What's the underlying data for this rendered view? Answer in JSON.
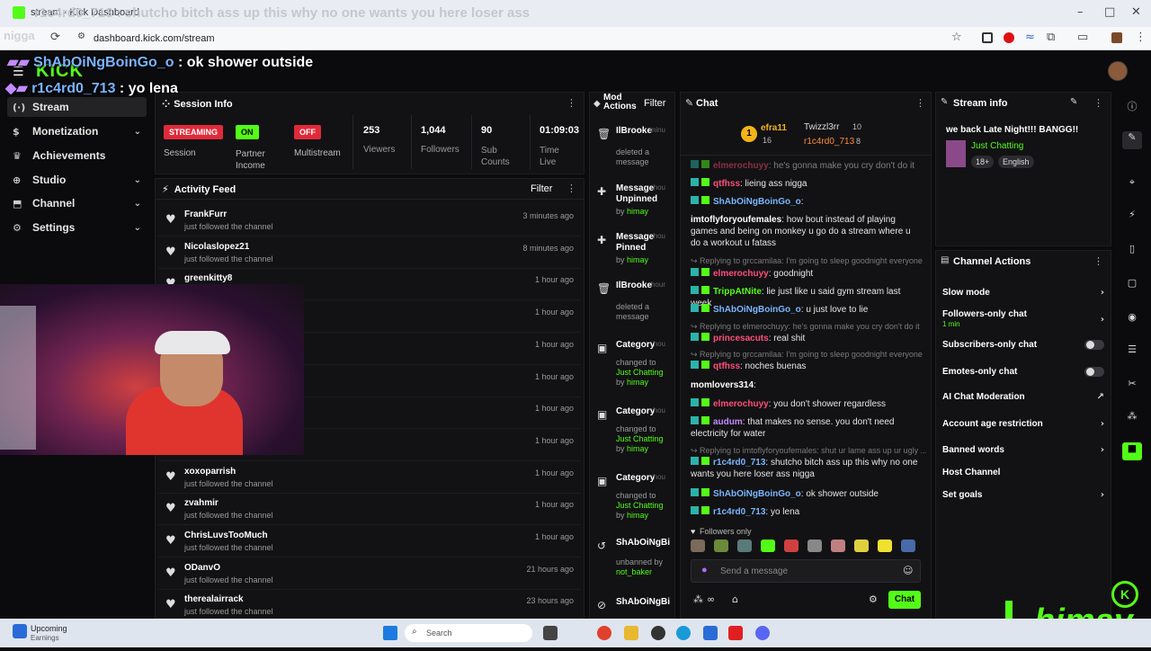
{
  "browser": {
    "tab_title": "stream - Kick Dashboard",
    "url": "dashboard.kick.com/stream",
    "minimize": "–",
    "maximize": "□",
    "close": "✕"
  },
  "overlay": {
    "top_text": "r1c4rd0_713 : shutcho bitch ass up this why no one wants you here loser ass",
    "top_left_fragment": "nigga",
    "line1_user": "ShAbOiNgBoinGo_o",
    "line1_msg": " : ok shower outside",
    "line2_user": "r1c4rd0_713",
    "line2_msg": " : yo lena",
    "brand_logo": "KICK",
    "streamer_logo": "himay"
  },
  "sidebar": {
    "items": [
      {
        "label": "Stream",
        "icon": "broadcast-icon"
      },
      {
        "label": "Monetization",
        "icon": "dollar-icon"
      },
      {
        "label": "Achievements",
        "icon": "trophy-icon"
      },
      {
        "label": "Studio",
        "icon": "studio-icon"
      },
      {
        "label": "Channel",
        "icon": "channel-icon"
      },
      {
        "label": "Settings",
        "icon": "gear-icon"
      }
    ]
  },
  "session": {
    "title": "Session Info",
    "streaming": "STREAMING",
    "streaming_label": "Session",
    "partner": "ON",
    "partner_label1": "Partner",
    "partner_label2": "Income",
    "multistream": "OFF",
    "multistream_label": "Multistream",
    "viewers": "253",
    "viewers_label": "Viewers",
    "followers": "1,044",
    "followers_label": "Followers",
    "subs": "90",
    "subs_label1": "Sub",
    "subs_label2": "Counts",
    "time": "01:09:03",
    "time_label1": "Time",
    "time_label2": "Live"
  },
  "activity": {
    "title": "Activity Feed",
    "filter": "Filter",
    "rows": [
      {
        "name": "FrankFurr",
        "sub": "just followed the channel",
        "time": "3 minutes ago"
      },
      {
        "name": "Nicolaslopez21",
        "sub": "just followed the channel",
        "time": "8 minutes ago"
      },
      {
        "name": "greenkitty8",
        "sub": "",
        "time": "1 hour ago"
      },
      {
        "name": "",
        "sub": "",
        "time": "1 hour ago"
      },
      {
        "name": "",
        "sub": "",
        "time": "1 hour ago"
      },
      {
        "name": "",
        "sub": "",
        "time": "1 hour ago"
      },
      {
        "name": "",
        "sub": "",
        "time": "1 hour ago"
      },
      {
        "name": "",
        "sub": "",
        "time": "1 hour ago"
      },
      {
        "name": "xoxoparrish",
        "sub": "just followed the channel",
        "time": "1 hour ago"
      },
      {
        "name": "zvahmir",
        "sub": "just followed the channel",
        "time": "1 hour ago"
      },
      {
        "name": "ChrisLuvsTooMuch",
        "sub": "just followed the channel",
        "time": "1 hour ago"
      },
      {
        "name": "ODanvO",
        "sub": "just followed the channel",
        "time": "21 hours ago"
      },
      {
        "name": "therealairrack",
        "sub": "just followed the channel",
        "time": "23 hours ago"
      }
    ]
  },
  "mod": {
    "title1": "Mod",
    "title2": "Actions",
    "filter": "Filter",
    "items": [
      {
        "icon": "trash-icon",
        "t": "IlBrooke",
        "d1": "deleted a",
        "d2": "message",
        "d3": "",
        "h": "minu"
      },
      {
        "icon": "pin-icon",
        "t": "Message Unpinned",
        "d1": "by",
        "d2": "himay",
        "d3": "",
        "h": "hou"
      },
      {
        "icon": "pin-icon",
        "t": "Message Pinned",
        "d1": "by",
        "d2": "himay",
        "d3": "",
        "h": "hou"
      },
      {
        "icon": "trash-icon",
        "t": "IlBrooke",
        "d1": "deleted a",
        "d2": "message",
        "d3": "",
        "h": "hour"
      },
      {
        "icon": "category-icon",
        "t": "Category",
        "d1": "changed to",
        "d2": "Just Chatting",
        "d3": "himay",
        "h": "hou"
      },
      {
        "icon": "category-icon",
        "t": "Category",
        "d1": "changed to",
        "d2": "Just Chatting",
        "d3": "himay",
        "h": "hou"
      },
      {
        "icon": "category-icon",
        "t": "Category",
        "d1": "changed to",
        "d2": "Just Chatting",
        "d3": "himay",
        "h": "hou"
      },
      {
        "icon": "unban-icon",
        "t": "ShAbOiNgBi",
        "d1": "unbanned by",
        "d2": "not_baker",
        "d3": "",
        "h": ""
      },
      {
        "icon": "ban-icon",
        "t": "ShAbOiNgBi",
        "d1": "",
        "d2": "",
        "d3": "",
        "h": ""
      }
    ]
  },
  "chat": {
    "title": "Chat",
    "top_gifter": "efra11",
    "top_gifter_count": "16",
    "top2": "Twizzl3rr",
    "top2_count": "10",
    "top3": "r1c4rd0_713",
    "top3_count": "8",
    "lines": [
      {
        "u": "elmerochuyy",
        "c": "#ff4e7a",
        "m": ": he's gonna make you cry don't do it"
      },
      {
        "u": "qtfhss",
        "c": "#ff4e7a",
        "m": ": lieing ass nigga"
      },
      {
        "u": "ShAbOiNgBoinGo_o",
        "c": "#7ab6ff",
        "m": ":"
      },
      {
        "u": "imtoflyforyoufemales",
        "c": "#ffffff",
        "m": ": how bout instead of playing games and being on monkey u go do a stream where u do a workout u fatass"
      },
      {
        "u": "elmerochuyy",
        "c": "#ff4e7a",
        "m": ": goodnight"
      },
      {
        "u": "TrippAtNite",
        "c": "#53fc18",
        "m": ": lie just like u said gym stream last week"
      },
      {
        "u": "ShAbOiNgBoinGo_o",
        "c": "#7ab6ff",
        "m": ": u just love to lie"
      },
      {
        "u": "princesacuts",
        "c": "#ff4e7a",
        "m": ": real shit"
      },
      {
        "u": "qtfhss",
        "c": "#ff4e7a",
        "m": ": noches buenas"
      },
      {
        "u": "momlovers314",
        "c": "#ffffff",
        "m": ":"
      },
      {
        "u": "elmerochuyy",
        "c": "#ff4e7a",
        "m": ": you don't shower regardless"
      },
      {
        "u": "audum",
        "c": "#c28bff",
        "m": ": that makes no sense. you don't need electricity for water"
      },
      {
        "u": "r1c4rd0_713",
        "c": "#7ab6ff",
        "m": ": shutcho bitch ass up this why no one wants you here loser ass nigga"
      },
      {
        "u": "ShAbOiNgBoinGo_o",
        "c": "#7ab6ff",
        "m": ": ok shower outside"
      },
      {
        "u": "r1c4rd0_713",
        "c": "#7ab6ff",
        "m": ": yo lena"
      }
    ],
    "replies": [
      "Replying to grccamilaa: I'm going to sleep goodnight everyone",
      "Replying to elmerochuyy: he's gonna make you cry don't do it",
      "Replying to grccamilaa: I'm going to sleep goodnight everyone",
      "Replying to imtoflyforyoufemales: shut ur lame ass up ur ugly ..."
    ],
    "followers_only": "Followers only",
    "placeholder": "Send a message",
    "send": "Chat"
  },
  "stream_info": {
    "title": "Stream info",
    "stream_title": "we back Late Night!!! BANGG!!",
    "category": "Just Chatting",
    "tag1": "18+",
    "tag2": "English"
  },
  "channel_actions": {
    "title": "Channel Actions",
    "rows": [
      {
        "label": "Slow mode",
        "kind": "arrow",
        "sub": ""
      },
      {
        "label": "Followers-only chat",
        "kind": "arrow",
        "sub": "1 min"
      },
      {
        "label": "Subscribers-only chat",
        "kind": "toggle",
        "sub": ""
      },
      {
        "label": "Emotes-only chat",
        "kind": "toggle",
        "sub": ""
      },
      {
        "label": "AI Chat Moderation",
        "kind": "external",
        "sub": ""
      },
      {
        "label": "Account age restriction",
        "kind": "arrow",
        "sub": ""
      },
      {
        "label": "Banned words",
        "kind": "arrow",
        "sub": ""
      },
      {
        "label": "Host Channel",
        "kind": "none",
        "sub": ""
      },
      {
        "label": "Set goals",
        "kind": "arrow",
        "sub": ""
      }
    ]
  },
  "taskbar": {
    "weather1": "Upcoming",
    "weather2": "Earnings",
    "search": "Search"
  },
  "colors": {
    "kick_green": "#53fc18",
    "streaming_red": "#e02a3a",
    "panel": "#121214"
  }
}
